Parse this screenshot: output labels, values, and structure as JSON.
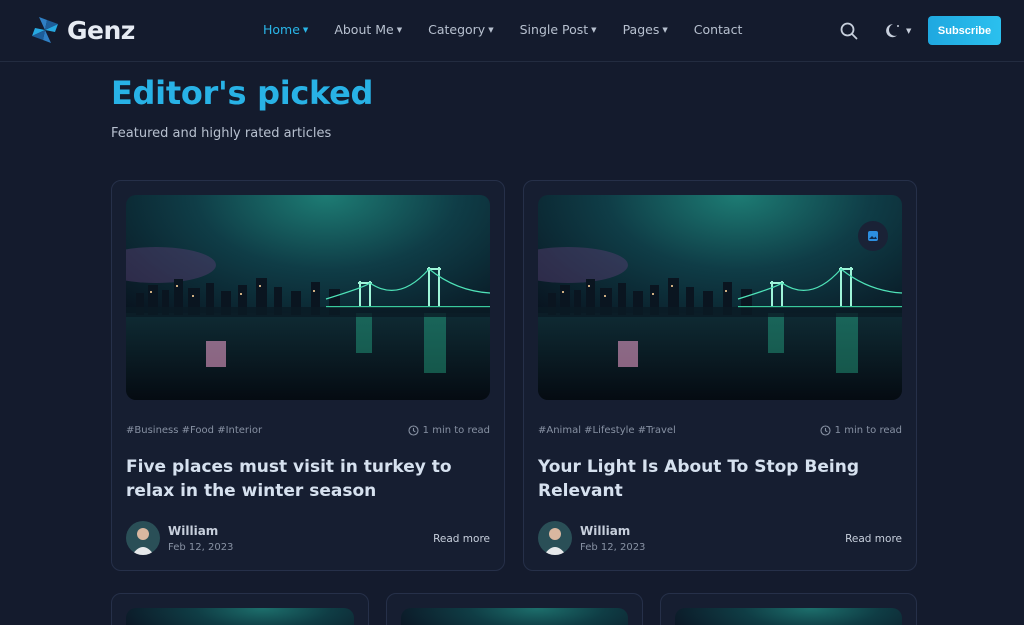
{
  "brand": {
    "name": "Genz",
    "logo_icon": "pinwheel-logo-icon",
    "accent": "#28b2e6"
  },
  "nav": {
    "items": [
      {
        "label": "Home",
        "dropdown": true,
        "active": true
      },
      {
        "label": "About Me",
        "dropdown": true
      },
      {
        "label": "Category",
        "dropdown": true
      },
      {
        "label": "Single Post",
        "dropdown": true
      },
      {
        "label": "Pages",
        "dropdown": true
      },
      {
        "label": "Contact",
        "dropdown": false
      }
    ],
    "search_icon": "search-icon",
    "theme_icon": "moon-icon",
    "subscribe_label": "Subscribe"
  },
  "section": {
    "title": "Editor's picked",
    "subtitle": "Featured and highly rated articles"
  },
  "cards": [
    {
      "tags": "#Business #Food #Interior",
      "read_time": "1 min to read",
      "title": "Five places must visit in turkey to relax in the winter season",
      "author": "William",
      "date": "Feb 12, 2023",
      "read_more": "Read more"
    },
    {
      "tags": "#Animal #Lifestyle #Travel",
      "read_time": "1 min to read",
      "title": "Your Light Is About To Stop Being Relevant",
      "author": "William",
      "date": "Feb 12, 2023",
      "read_more": "Read more",
      "badge_icon": "image-icon"
    }
  ],
  "colors": {
    "background": "#141b2d",
    "card": "#161e31",
    "title": "#d6e1ef",
    "muted": "#8791a3"
  }
}
